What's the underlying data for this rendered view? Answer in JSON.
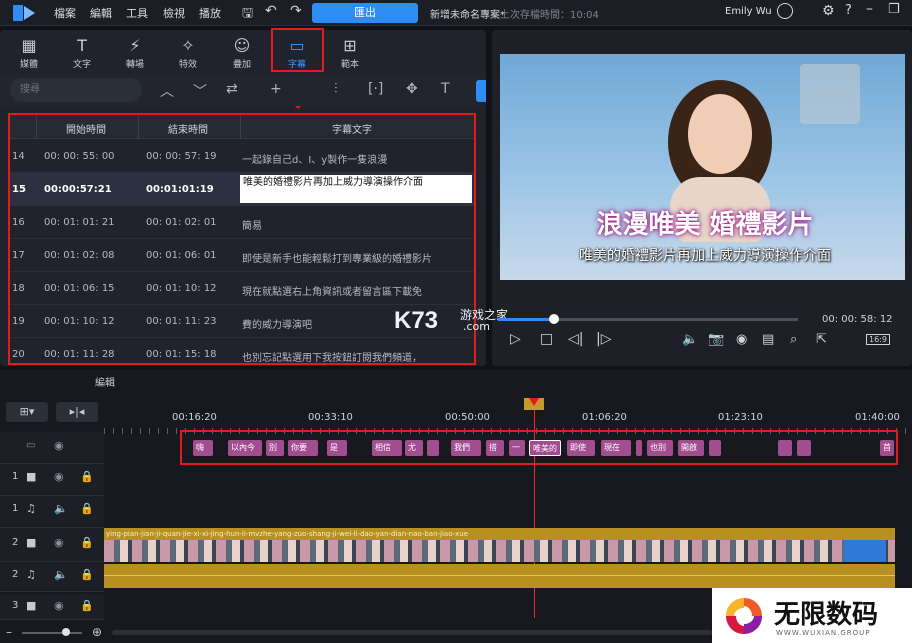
{
  "menu": {
    "items": [
      "檔案",
      "編輯",
      "工具",
      "檢視",
      "播放"
    ],
    "export_label": "匯出",
    "project_title": "新增未命名專案*",
    "last_saved": "上次存檔時間：10:04",
    "user": "Emily Wu"
  },
  "tabs": [
    {
      "label": "媒體",
      "icon": "media-icon"
    },
    {
      "label": "文字",
      "icon": "text-icon"
    },
    {
      "label": "轉場",
      "icon": "transition-icon"
    },
    {
      "label": "特效",
      "icon": "effects-icon"
    },
    {
      "label": "疊加",
      "icon": "overlay-icon"
    },
    {
      "label": "字幕",
      "icon": "subtitle-icon",
      "selected": true
    },
    {
      "label": "範本",
      "icon": "template-icon"
    }
  ],
  "search": {
    "placeholder": "搜尋"
  },
  "subtitle_table": {
    "headers": [
      "開始時間",
      "結束時間",
      "字幕文字"
    ],
    "rows": [
      {
        "n": "14",
        "start": "00: 00: 55: 00",
        "end": "00: 00: 57: 19",
        "text": "一起錄自己d、I、y製作一隻浪漫"
      },
      {
        "n": "15",
        "start": "00:00:57:21",
        "end": "00:01:01:19",
        "text": "唯美的婚禮影片再加上威力導演操作介面",
        "selected": true
      },
      {
        "n": "16",
        "start": "00: 01: 01: 21",
        "end": "00: 01: 02: 01",
        "text": "簡易"
      },
      {
        "n": "17",
        "start": "00: 01: 02: 08",
        "end": "00: 01: 06: 01",
        "text": "即使是新手也能輕鬆打到專業級的婚禮影片"
      },
      {
        "n": "18",
        "start": "00: 01: 06: 15",
        "end": "00: 01: 10: 12",
        "text": "現在就點選右上角資訊或者留言區下載免"
      },
      {
        "n": "19",
        "start": "00: 01: 10: 12",
        "end": "00: 01: 11: 23",
        "text": "費的威力導演吧"
      },
      {
        "n": "20",
        "start": "00: 01: 11: 28",
        "end": "00: 01: 15: 18",
        "text": "也別忘記點選用下我按鈕訂閱我們頻道，"
      }
    ]
  },
  "preview": {
    "video_title": "浪漫唯美 婚禮影片",
    "video_subtitle": "唯美的婚禮影片再加上威力導演操作介面",
    "timecode": "00: 00: 58: 12",
    "aspect": "16:9",
    "watermark": "K73",
    "watermark_sub": "游戏之家",
    "watermark_domain": ".com"
  },
  "timeline": {
    "panel_label": "編輯",
    "ruler": [
      "00:16:20",
      "00:33:10",
      "00:50:00",
      "01:06:20",
      "01:23:10",
      "01:40:00"
    ],
    "subtitle_clips": [
      "嗨",
      "以內今",
      "別",
      "你要",
      "是",
      "相信",
      "尤",
      "我們",
      "搭",
      "一",
      "唯美的",
      "即使",
      "現在",
      "也別",
      "開啟",
      "首"
    ],
    "video_clip_title": "ying-pian-jian-ji-quan-jie-xi-xi-jing-hun-li-mvzhe-yang-zuo-shang-ji-wei-li-dao-yan-dian-nao-ban-jiao-xue",
    "track_numbers": [
      "1",
      "1",
      "2",
      "2",
      "3"
    ]
  },
  "corner_logo": {
    "text": "无限数码",
    "sub": "WWW.WUXIAN.GROUP"
  },
  "colors": {
    "accent": "#2d8df5",
    "highlight": "#e21c1c",
    "clip": "#a24d8f",
    "gold": "#b8901f"
  }
}
